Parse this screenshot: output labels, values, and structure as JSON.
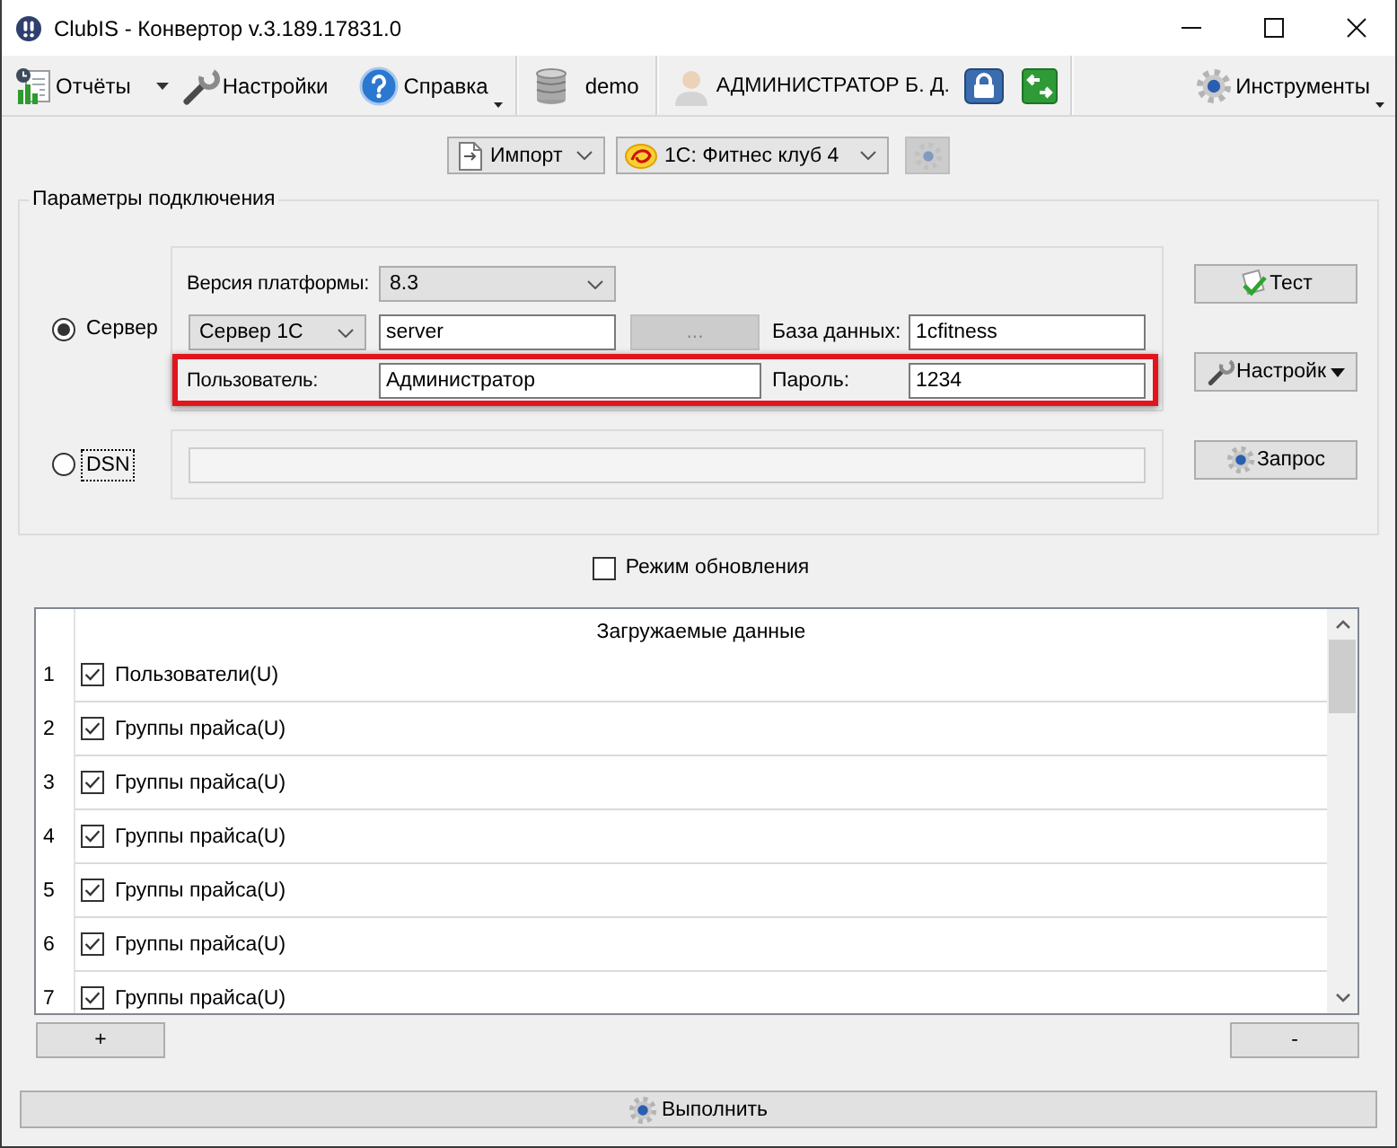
{
  "window": {
    "title": "ClubIS - Конвертор v.3.189.17831.0"
  },
  "toolbar": {
    "reports": "Отчёты",
    "settings": "Настройки",
    "help": "Справка",
    "database": "demo",
    "user": "АДМИНИСТРАТОР Б. Д.",
    "tools": "Инструменты"
  },
  "source": {
    "mode": "Импорт",
    "configuration": "1С: Фитнес клуб 4",
    "action_disabled": true
  },
  "connection": {
    "title": "Параметры подключения",
    "server_option": {
      "label": "Сервер",
      "selected": true,
      "focused": false
    },
    "dsn_option": {
      "label": "DSN",
      "selected": false,
      "focused": true
    },
    "platform_label": "Версия платформы:",
    "platform": "8.3",
    "server_type": "Сервер 1С",
    "server": "server",
    "browse": {
      "label": "...",
      "disabled": true
    },
    "database_label": "База данных:",
    "database": "1cfitness",
    "credentials": {
      "highlighted": true,
      "user_label": "Пользователь:",
      "user": "Администратор",
      "password_label": "Пароль:",
      "password": "1234"
    },
    "dsn_field": {
      "disabled": true
    },
    "buttons": [
      {
        "kind": "check",
        "label": "Тест"
      },
      {
        "kind": "wrench",
        "label": "Настройк"
      },
      {
        "kind": "gear",
        "label": "Запрос"
      }
    ]
  },
  "update_mode": {
    "label": "Режим обновления",
    "checked": false
  },
  "table": {
    "header": "Загружаемые данные",
    "rows": [
      {
        "number": "1",
        "label": "Пользователи(U)",
        "checked": true
      },
      {
        "number": "2",
        "label": "Группы прайса(U)",
        "checked": true
      },
      {
        "number": "3",
        "label": "Группы прайса(U)",
        "checked": true
      },
      {
        "number": "4",
        "label": "Группы прайса(U)",
        "checked": true
      },
      {
        "number": "5",
        "label": "Группы прайса(U)",
        "checked": true
      },
      {
        "number": "6",
        "label": "Группы прайса(U)",
        "checked": true
      },
      {
        "number": "7",
        "label": "Группы прайса(U)",
        "checked": true
      }
    ]
  },
  "add_button": "+",
  "remove_button": "-",
  "run_button": "Выполнить"
}
